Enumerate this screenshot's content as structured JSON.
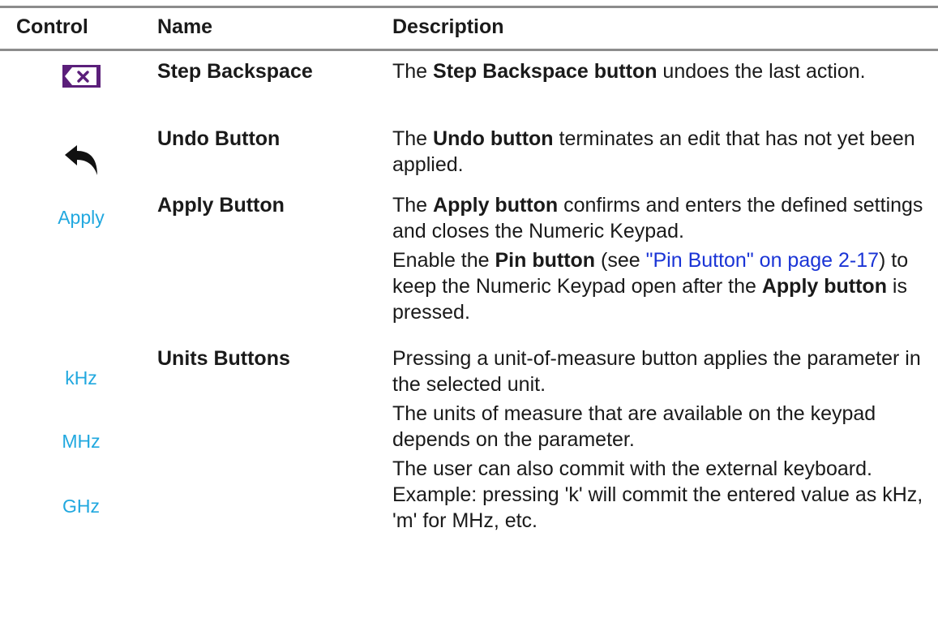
{
  "headers": {
    "control": "Control",
    "name": "Name",
    "description": "Description"
  },
  "rows": [
    {
      "name": "Step Backspace",
      "icon": "backspace-icon",
      "description": [
        [
          {
            "t": "The "
          },
          {
            "t": "Step Backspace button",
            "b": true
          },
          {
            "t": " undoes the last action."
          }
        ]
      ]
    },
    {
      "name": "Undo Button",
      "icon": "undo-arrow-icon",
      "description": [
        [
          {
            "t": "The "
          },
          {
            "t": "Undo button",
            "b": true
          },
          {
            "t": " terminates an edit that has not yet been applied."
          }
        ]
      ]
    },
    {
      "name": "Apply Button",
      "control_label": "Apply",
      "description": [
        [
          {
            "t": "The "
          },
          {
            "t": "Apply button",
            "b": true
          },
          {
            "t": " confirms and enters the defined settings and closes the Numeric Keypad."
          }
        ],
        [
          {
            "t": "Enable the "
          },
          {
            "t": "Pin button",
            "b": true
          },
          {
            "t": " (see "
          },
          {
            "t": "\"Pin Button\" on page 2-17",
            "link": true
          },
          {
            "t": ") to keep the Numeric Keypad open after the "
          },
          {
            "t": "Apply button",
            "b": true
          },
          {
            "t": " is pressed."
          }
        ]
      ]
    },
    {
      "name": "Units Buttons",
      "control_labels": [
        "kHz",
        "MHz",
        "GHz"
      ],
      "description": [
        [
          {
            "t": "Pressing a unit-of-measure button applies the parameter in the selected unit."
          }
        ],
        [
          {
            "t": "The units of measure that are available on the keypad depends on the parameter."
          }
        ],
        [
          {
            "t": "The user can also commit with the external keyboard. Example: pressing 'k' will commit the entered value as kHz, 'm' for MHz, etc."
          }
        ]
      ]
    }
  ],
  "colors": {
    "rule": "#8c8c8c",
    "backspace_bg": "#5b1f7a",
    "button_text": "#21a8df",
    "link": "#1a34d6"
  }
}
